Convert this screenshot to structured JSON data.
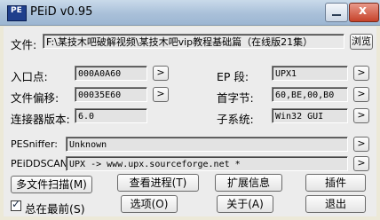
{
  "window": {
    "title": "PEiD v0.95",
    "icon_text": "PE",
    "min_icon": "minimize-icon",
    "close_symbol": "x"
  },
  "file": {
    "label": "文件:",
    "path": "F:\\某技木吧破解视频\\某技木吧vip教程基础篇（在线版21集）",
    "browse_label": "浏览"
  },
  "fields": {
    "entry_point": {
      "label": "入口点:",
      "value": "000A0A60"
    },
    "file_offset": {
      "label": "文件偏移:",
      "value": "00035E60"
    },
    "linker_version": {
      "label": "连接器版本:",
      "value": "6.0"
    },
    "ep_section": {
      "label": "EP 段:",
      "value": "UPX1"
    },
    "first_bytes": {
      "label": "首字节:",
      "value": "60,BE,00,B0"
    },
    "subsystem": {
      "label": "子系统:",
      "value": "Win32 GUI"
    }
  },
  "arrow_symbol": ">",
  "pesniffer": {
    "label": "PESniffer:",
    "value": "Unknown"
  },
  "peiddscan": {
    "label": "PEiDDSCAN:",
    "value": "UPX -> www.upx.sourceforge.net *"
  },
  "buttons": {
    "multi_scan": "多文件扫描(M)",
    "task_viewer": "查看进程(T)",
    "extra_info": "扩展信息",
    "plugins": "插件",
    "options": "选项(O)",
    "about": "关于(A)",
    "exit": "退出"
  },
  "always_on_top": {
    "label": "总在最前(S)",
    "checked": true,
    "mark": "✓"
  }
}
